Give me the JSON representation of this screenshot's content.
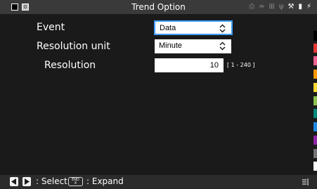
{
  "header": {
    "title": "Trend Option",
    "left_badge": "0",
    "status_icons": [
      "printer-icon",
      "wifi-icon",
      "network-icon",
      "usb-icon",
      "wrench-icon",
      "sd-card-icon",
      "plug-icon"
    ]
  },
  "form": {
    "event": {
      "label": "Event",
      "value": "Data"
    },
    "resolution_unit": {
      "label": "Resolution unit",
      "value": "Minute"
    },
    "resolution": {
      "label": "Resolution",
      "value": "10",
      "range": "[ 1 - 240 ]"
    }
  },
  "bottom": {
    "select_text": ": Select",
    "end_key_top": "END",
    "end_key_bottom": "X",
    "expand_text": ": Expand"
  },
  "colors": {
    "background": "#1a1a1a",
    "topbar": "#3a3a3a",
    "focus": "#3f9cff",
    "channel_colors": [
      "#000000",
      "#e53935",
      "#f06292",
      "#ff9800",
      "#fdd835",
      "#8bc34a",
      "#00897b",
      "#1e88e5",
      "#8e24aa",
      "#757575",
      "#ffffff"
    ]
  }
}
